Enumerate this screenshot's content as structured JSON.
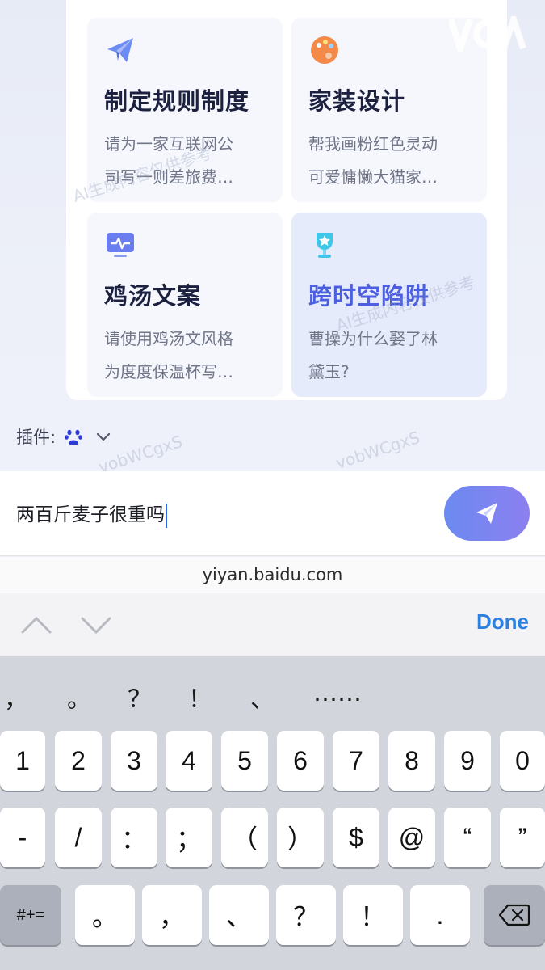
{
  "cards": [
    {
      "title": "制定规则制度",
      "desc_line1": "请为一家互联网公",
      "desc_line2": "司写一则差旅费…",
      "icon": "paper-plane-icon"
    },
    {
      "title": "家装设计",
      "desc_line1": "帮我画粉红色灵动",
      "desc_line2": "可爱慵懒大猫家…",
      "icon": "palette-icon"
    },
    {
      "title": "鸡汤文案",
      "desc_line1": "请使用鸡汤文风格",
      "desc_line2": "为度度保温杯写…",
      "icon": "monitor-pulse-icon"
    },
    {
      "title": "跨时空陷阱",
      "desc_line1": "曹操为什么娶了林",
      "desc_line2": "黛玉?",
      "icon": "trophy-icon"
    }
  ],
  "plugin": {
    "label": "插件:",
    "icon": "baidu-paw-icon"
  },
  "input": {
    "value": "两百斤麦子很重吗"
  },
  "url": "yiyan.baidu.com",
  "accessory": {
    "done_label": "Done"
  },
  "keyboard": {
    "candidates": [
      "，",
      "。",
      "？",
      "！",
      "、",
      "……"
    ],
    "row1": [
      "1",
      "2",
      "3",
      "4",
      "5",
      "6",
      "7",
      "8",
      "9",
      "0"
    ],
    "row2": [
      "-",
      "/",
      "：",
      "；",
      "（",
      "）",
      "$",
      "@",
      "“",
      "”"
    ],
    "row3": [
      "#+=",
      "。",
      "，",
      "、",
      "？",
      "！",
      "."
    ]
  },
  "watermark": {
    "line1": "AI生成内容仅供参考",
    "line2": "vobWCgxS"
  },
  "colors": {
    "accent": "#4c5fe0",
    "done": "#2d7fe0",
    "send_start": "#6b8af0",
    "send_end": "#8c7ff0"
  }
}
